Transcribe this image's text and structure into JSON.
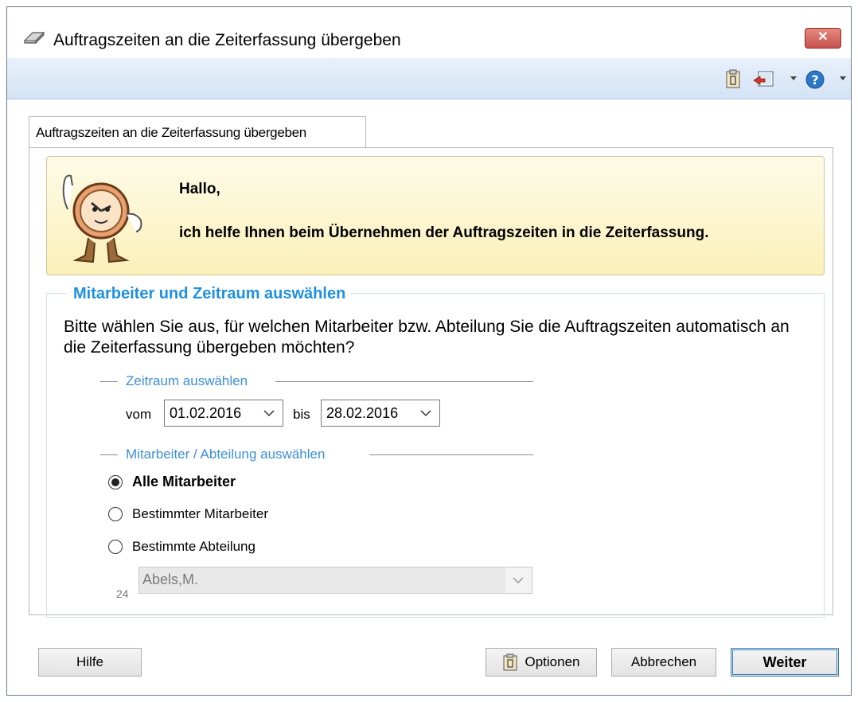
{
  "window": {
    "title": "Auftragszeiten an die Zeiterfassung übergeben",
    "close_label": "✕"
  },
  "toolbar": {
    "icons": [
      "clipboard-icon",
      "exit-icon",
      "dropdown-arrow-icon",
      "help-icon",
      "dropdown-arrow-icon"
    ]
  },
  "tab": {
    "label": "Auftragszeiten an die Zeiterfassung übergeben"
  },
  "banner": {
    "greeting": "Hallo,",
    "text": "ich helfe Ihnen beim Übernehmen der Auftragszeiten in die Zeiterfassung."
  },
  "group": {
    "title": "Mitarbeiter und Zeitraum auswählen",
    "intro": "Bitte wählen Sie aus, für welchen Mitarbeiter bzw. Abteilung Sie die Auftragszeiten automatisch an die Zeiterfassung übergeben möchten?"
  },
  "zeitraum": {
    "title": "Zeitraum auswählen",
    "from_label": "vom",
    "from_value": "01.02.2016",
    "to_label": "bis",
    "to_value": "28.02.2016"
  },
  "mitarbeiter": {
    "title": "Mitarbeiter / Abteilung auswählen",
    "options": [
      {
        "label": "Alle Mitarbeiter",
        "checked": true
      },
      {
        "label": "Bestimmter Mitarbeiter",
        "checked": false
      },
      {
        "label": "Bestimmte Abteilung",
        "checked": false
      }
    ],
    "combo_number": "24",
    "combo_value": "Abels,M."
  },
  "buttons": {
    "help": "Hilfe",
    "options": "Optionen",
    "cancel": "Abbrechen",
    "next": "Weiter"
  },
  "colors": {
    "accent": "#1e90e0",
    "subtitle": "#3c8fd9",
    "toolbar_top": "#e9f1fb",
    "toolbar_bottom": "#d3e3f5",
    "banner_top": "#fdfbe8",
    "banner_bottom": "#fbf0b9",
    "close_button": "#c75050"
  }
}
